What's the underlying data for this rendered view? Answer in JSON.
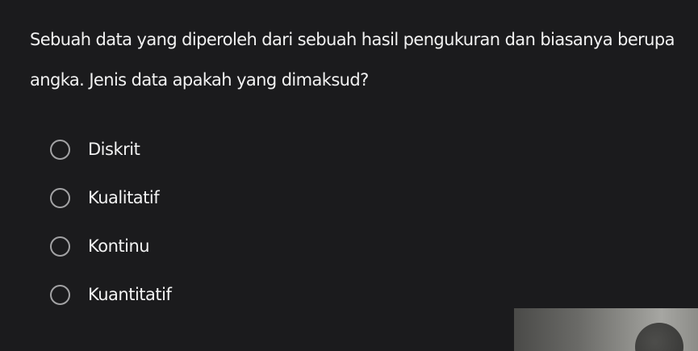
{
  "question": {
    "text": "Sebuah data yang diperoleh dari sebuah hasil pengukuran dan biasanya berupa angka. Jenis data apakah yang dimaksud?"
  },
  "options": [
    {
      "label": "Diskrit",
      "selected": false
    },
    {
      "label": "Kualitatif",
      "selected": false
    },
    {
      "label": "Kontinu",
      "selected": false
    },
    {
      "label": "Kuantitatif",
      "selected": false
    }
  ],
  "colors": {
    "background": "#1b1b1d",
    "text": "#f2f2f2",
    "radio_border": "#a2a2a4"
  }
}
